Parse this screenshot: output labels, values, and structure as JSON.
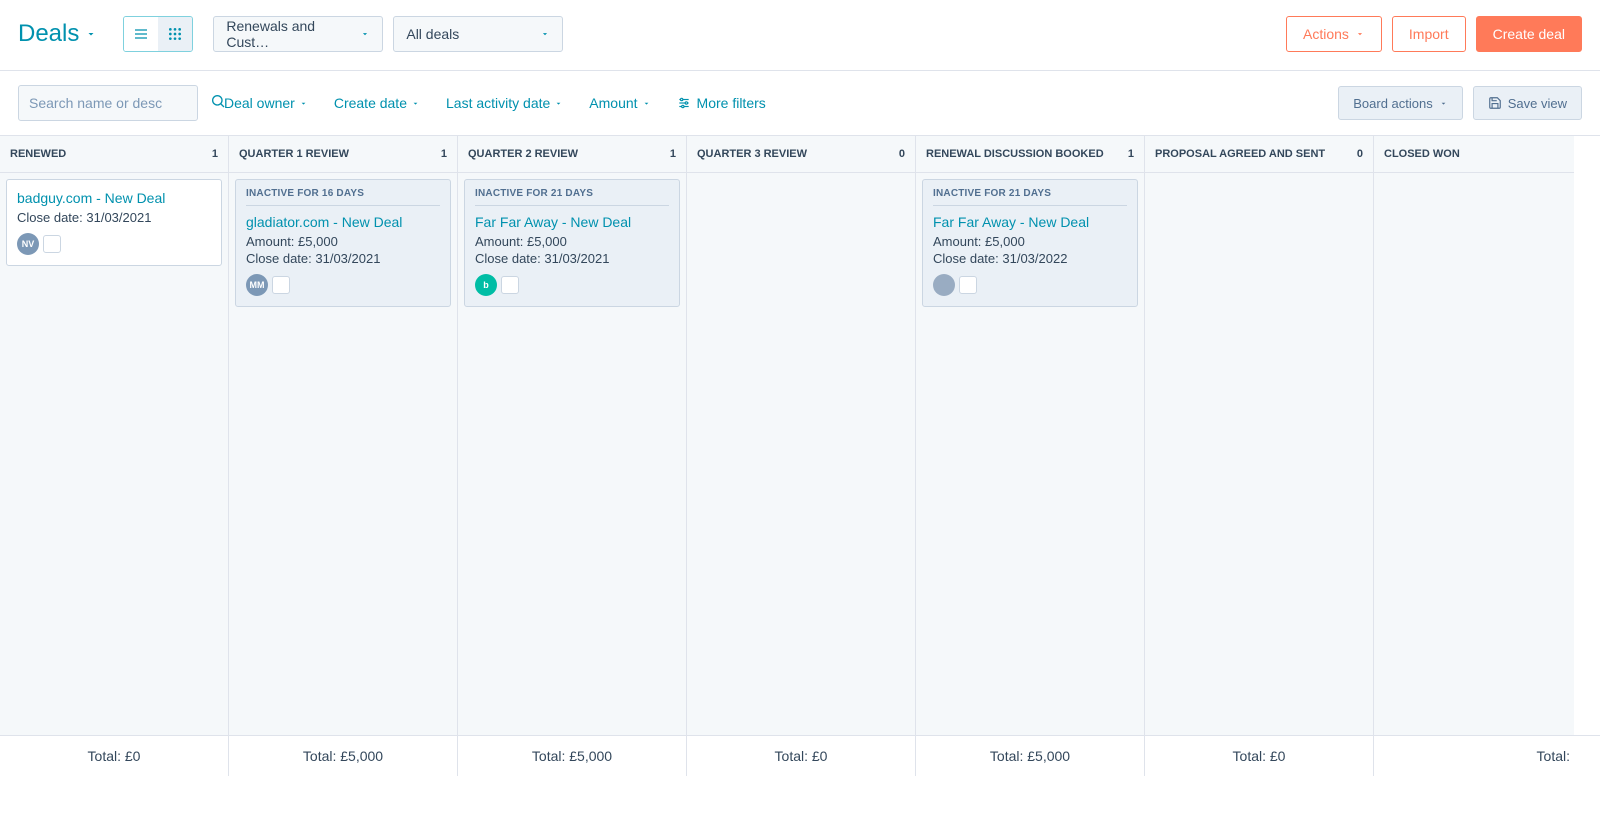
{
  "header": {
    "title": "Deals",
    "pipeline": "Renewals and Cust…",
    "deal_filter": "All deals",
    "actions": "Actions",
    "import": "Import",
    "create": "Create deal"
  },
  "filters": {
    "search_placeholder": "Search name or desc",
    "deal_owner": "Deal owner",
    "create_date": "Create date",
    "last_activity": "Last activity date",
    "amount": "Amount",
    "more_filters": "More filters",
    "board_actions": "Board actions",
    "save_view": "Save view"
  },
  "columns": [
    {
      "name": "RENEWED",
      "count": "1",
      "cards": [
        {
          "inactive": "",
          "title": "badguy.com - New Deal",
          "amount": "",
          "close": "31/03/2021",
          "avatar_text": "NV",
          "avatar_class": ""
        }
      ],
      "total": "Total: £0"
    },
    {
      "name": "QUARTER 1 REVIEW",
      "count": "1",
      "cards": [
        {
          "inactive": "INACTIVE FOR 16 DAYS",
          "title": "gladiator.com - New Deal",
          "amount": "£5,000",
          "close": "31/03/2021",
          "avatar_text": "MM",
          "avatar_class": ""
        }
      ],
      "total": "Total: £5,000"
    },
    {
      "name": "QUARTER 2 REVIEW",
      "count": "1",
      "cards": [
        {
          "inactive": "INACTIVE FOR 21 DAYS",
          "title": "Far Far Away - New Deal",
          "amount": "£5,000",
          "close": "31/03/2021",
          "avatar_text": "b",
          "avatar_class": "green"
        }
      ],
      "total": "Total: £5,000"
    },
    {
      "name": "QUARTER 3 REVIEW",
      "count": "0",
      "cards": [],
      "total": "Total: £0"
    },
    {
      "name": "RENEWAL DISCUSSION BOOKED",
      "count": "1",
      "cards": [
        {
          "inactive": "INACTIVE FOR 21 DAYS",
          "title": "Far Far Away - New Deal",
          "amount": "£5,000",
          "close": "31/03/2022",
          "avatar_text": "",
          "avatar_class": "img"
        }
      ],
      "total": "Total: £5,000"
    },
    {
      "name": "PROPOSAL AGREED AND SENT",
      "count": "0",
      "cards": [],
      "total": "Total: £0"
    },
    {
      "name": "CLOSED WON",
      "count": "",
      "cards": [],
      "total": "Total:"
    }
  ],
  "labels": {
    "amount_label": "Amount: ",
    "close_label": "Close date: "
  }
}
